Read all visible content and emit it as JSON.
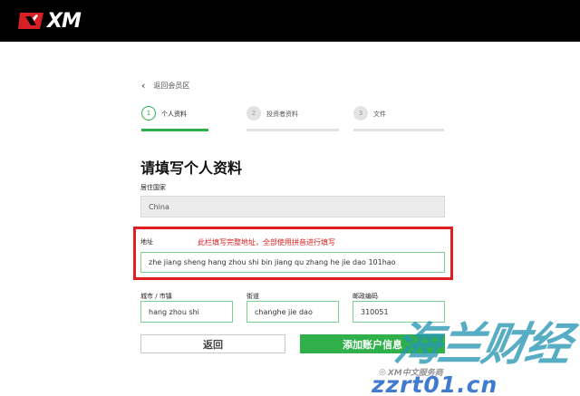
{
  "header": {
    "logo_text": "XM"
  },
  "nav": {
    "back_link": "返回会员区"
  },
  "steps": [
    {
      "number": "1",
      "label": "个人资料"
    },
    {
      "number": "2",
      "label": "投资者资料"
    },
    {
      "number": "3",
      "label": "文件"
    }
  ],
  "form": {
    "title": "请填写个人资料",
    "country_label": "居住国家",
    "country_value": "China",
    "address_label": "地址",
    "address_value": "zhe jiang sheng hang zhou shi bin jiang qu zhang he jie dao 101hao",
    "city_label": "城市 / 市镇",
    "city_value": "hang zhou shi",
    "street_label": "街道",
    "street_value": "changhe jie dao",
    "postcode_label": "邮政编码",
    "postcode_value": "310051"
  },
  "annotation": {
    "note": "此栏填写完整地址，全部使用拼音进行填写"
  },
  "buttons": {
    "back": "返回",
    "add": "添加账户信息"
  },
  "watermark": {
    "big": "海兰财经",
    "url": "zzrt01.cn",
    "small": "XM中文服务商"
  },
  "colors": {
    "accent_green": "#2fb04b",
    "annotation_red": "#e02020",
    "header_black": "#000000"
  }
}
